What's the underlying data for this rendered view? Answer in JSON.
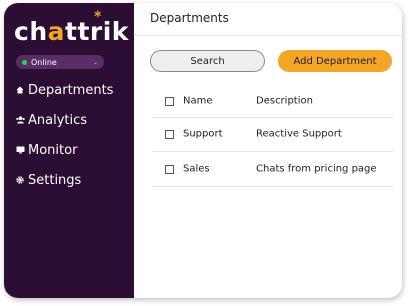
{
  "brand": {
    "name_left": "ch",
    "name_bubble": "a",
    "name_right": "ttrik",
    "star": "*"
  },
  "status": {
    "label": "Online",
    "chevron": "⌄"
  },
  "sidebar": {
    "items": [
      {
        "label": "Departments",
        "icon": "home-icon"
      },
      {
        "label": "Analytics",
        "icon": "users-icon"
      },
      {
        "label": "Monitor",
        "icon": "monitor-icon"
      },
      {
        "label": "Settings",
        "icon": "gear-icon"
      }
    ]
  },
  "main": {
    "title": "Departments",
    "search_label": "Search",
    "add_label": "Add Department",
    "table": {
      "headers": {
        "name": "Name",
        "description": "Description"
      },
      "rows": [
        {
          "name": "Support",
          "description": "Reactive Support"
        },
        {
          "name": "Sales",
          "description": "Chats from pricing page"
        }
      ]
    }
  },
  "colors": {
    "sidebar": "#2c0d33",
    "accent": "#f3a526",
    "status_pill": "#5a2d66",
    "online_dot": "#2fd24c"
  }
}
